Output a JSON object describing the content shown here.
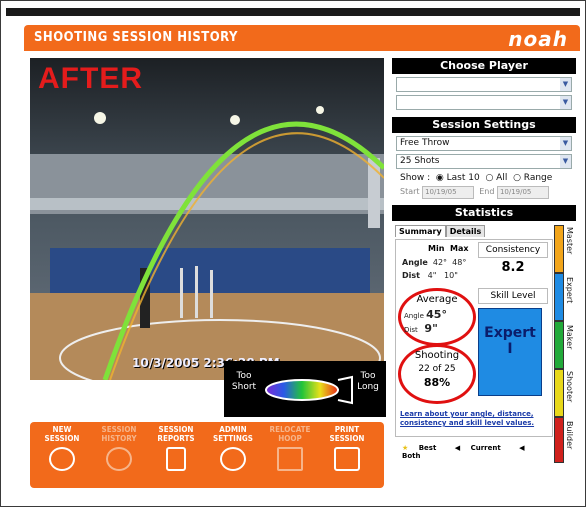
{
  "header": {
    "title": "SHOOTING SESSION HISTORY",
    "logo": "noah"
  },
  "video": {
    "overlay_label": "AFTER",
    "timestamp": "10/3/2005 2:36:28 PM"
  },
  "legend": {
    "short_label": "Too Short",
    "long_label": "Too Long"
  },
  "nav": [
    {
      "label": "NEW SESSION",
      "icon": "basketball-icon",
      "enabled": true
    },
    {
      "label": "SESSION HISTORY",
      "icon": "basketball-icon",
      "enabled": false
    },
    {
      "label": "SESSION REPORTS",
      "icon": "report-icon",
      "enabled": true
    },
    {
      "label": "ADMIN SETTINGS",
      "icon": "settings-icon",
      "enabled": true
    },
    {
      "label": "RELOCATE HOOP",
      "icon": "hoop-icon",
      "enabled": false
    },
    {
      "label": "PRINT SESSION",
      "icon": "print-icon",
      "enabled": true
    }
  ],
  "choose_player": {
    "title": "Choose Player",
    "select1": "",
    "select2": ""
  },
  "session_settings": {
    "title": "Session Settings",
    "shot_type": "Free Throw",
    "shots": "25 Shots",
    "show_label": "Show :",
    "show_options": [
      "Last 10",
      "All",
      "Range"
    ],
    "start_label": "Start",
    "start_value": "10/19/05",
    "end_label": "End",
    "end_value": "10/19/05"
  },
  "statistics": {
    "title": "Statistics",
    "tabs": [
      "Summary",
      "Details"
    ],
    "minmax_header": [
      "Min",
      "Max"
    ],
    "angle_row": {
      "label": "Angle",
      "min": "42°",
      "max": "48°"
    },
    "dist_row": {
      "label": "Dist",
      "min": "4\"",
      "max": "10\""
    },
    "consistency_label": "Consistency",
    "consistency_value": "8.2",
    "average_title": "Average",
    "avg_angle_label": "Angle",
    "avg_angle_value": "45°",
    "avg_dist_label": "Dist",
    "avg_dist_value": "9\"",
    "skill_level_label": "Skill Level",
    "skill_level_value": "Expert",
    "skill_level_tier": "I",
    "shooting_title": "Shooting",
    "shooting_made": "22 of 25",
    "shooting_pct": "88%",
    "learn_link": "Learn about your angle, distance, consistency and skill level values.",
    "key_best": "Best",
    "key_current": "Current",
    "key_both": "Both"
  },
  "ladder": {
    "ranks": [
      "Master",
      "Expert",
      "Maker",
      "Shooter",
      "Builder"
    ],
    "colors": [
      "#f2a51a",
      "#1f8be3",
      "#22aa3a",
      "#e8d81a",
      "#d0211d"
    ]
  },
  "colors": {
    "accent": "#f26a1b",
    "ring": "#e01010",
    "skill": "#1f8be3"
  }
}
